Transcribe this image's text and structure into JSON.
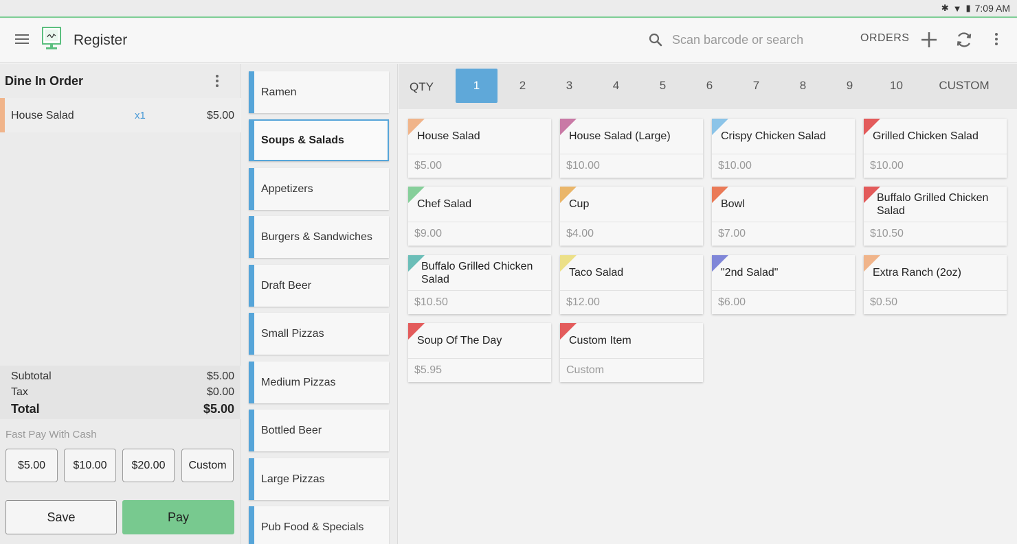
{
  "status_bar": {
    "time": "7:09 AM"
  },
  "app_bar": {
    "title": "Register",
    "search_placeholder": "Scan barcode or search",
    "orders_label": "ORDERS"
  },
  "order": {
    "title": "Dine In Order",
    "lines": [
      {
        "name": "House Salad",
        "qty": "x1",
        "price": "$5.00"
      }
    ],
    "subtotal_label": "Subtotal",
    "subtotal": "$5.00",
    "tax_label": "Tax",
    "tax": "$0.00",
    "total_label": "Total",
    "total": "$5.00",
    "fast_pay_label": "Fast Pay With Cash",
    "cash_options": [
      "$5.00",
      "$10.00",
      "$20.00",
      "Custom"
    ],
    "save_label": "Save",
    "pay_label": "Pay"
  },
  "categories": [
    "Ramen",
    "Soups & Salads",
    "Appetizers",
    "Burgers & Sandwiches",
    "Draft Beer",
    "Small Pizzas",
    "Medium Pizzas",
    "Bottled Beer",
    "Large Pizzas",
    "Pub Food & Specials"
  ],
  "active_category": "Soups & Salads",
  "quantity": {
    "label": "QTY",
    "options": [
      "1",
      "2",
      "3",
      "4",
      "5",
      "6",
      "7",
      "8",
      "9",
      "10",
      "CUSTOM"
    ],
    "selected": "1"
  },
  "items": [
    {
      "name": "House Salad",
      "price": "$5.00",
      "color": "#f0b48a"
    },
    {
      "name": "House Salad (Large)",
      "price": "$10.00",
      "color": "#c97aa6"
    },
    {
      "name": "Crispy Chicken Salad",
      "price": "$10.00",
      "color": "#8cc4e8"
    },
    {
      "name": "Grilled Chicken Salad",
      "price": "$10.00",
      "color": "#e35b5b"
    },
    {
      "name": "Chef Salad",
      "price": "$9.00",
      "color": "#86cf9a"
    },
    {
      "name": "Cup",
      "price": "$4.00",
      "color": "#eab66a"
    },
    {
      "name": "Bowl",
      "price": "$7.00",
      "color": "#ea7a57"
    },
    {
      "name": "Buffalo Grilled Chicken Salad",
      "price": "$10.50",
      "color": "#e35b5b"
    },
    {
      "name": "Buffalo Grilled Chicken Salad",
      "price": "$10.50",
      "color": "#6bbeb8"
    },
    {
      "name": "Taco Salad",
      "price": "$12.00",
      "color": "#ece088"
    },
    {
      "name": "\"2nd Salad\"",
      "price": "$6.00",
      "color": "#7f86d8"
    },
    {
      "name": "Extra Ranch (2oz)",
      "price": "$0.50",
      "color": "#f0b48a"
    },
    {
      "name": "Soup Of The Day",
      "price": "$5.95",
      "color": "#e35b5b"
    },
    {
      "name": "Custom Item",
      "price": "Custom",
      "color": "#e35b5b"
    }
  ]
}
